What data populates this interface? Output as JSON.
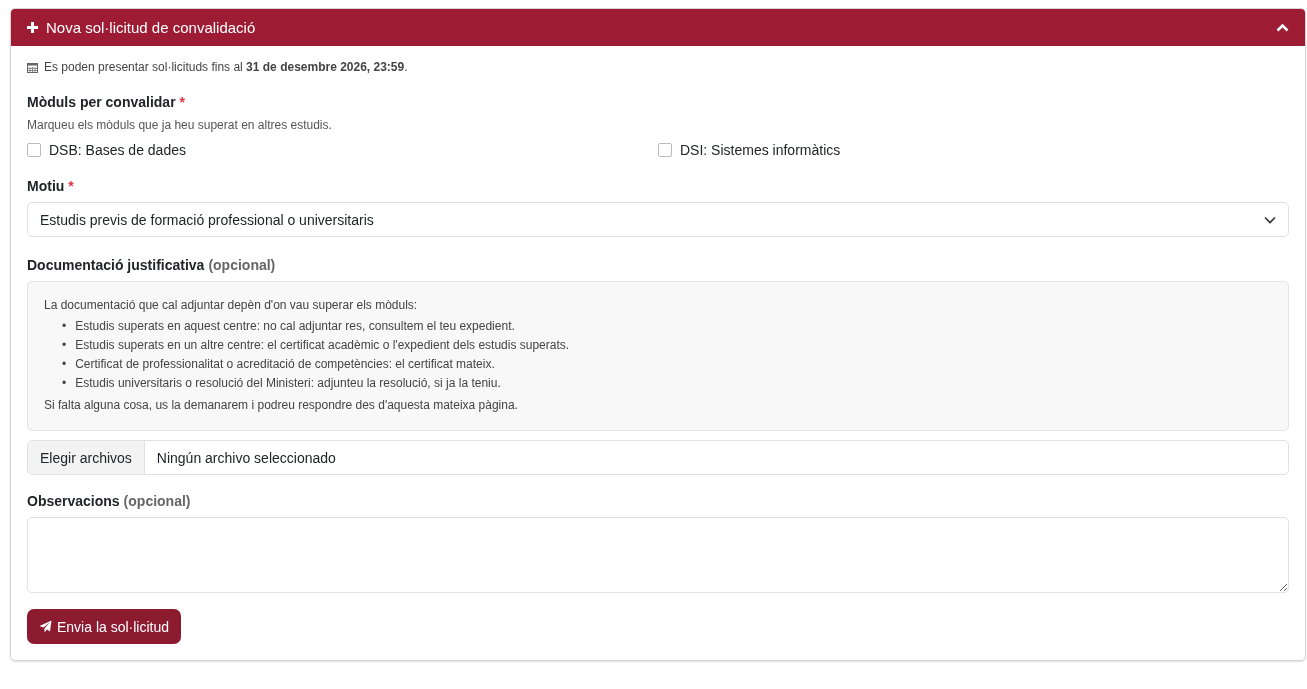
{
  "header": {
    "title": "Nova sol·licitud de convalidació",
    "expanded": true
  },
  "deadline": "Es poden presentar sol·licituds fins al **31 de desembre 2026, 23:59**.",
  "modules": {
    "label": "Mòduls per convalidar",
    "required_mark": "*",
    "hint": "Marqueu els mòduls que ja heu superat en altres estudis.",
    "options": [
      {
        "label": "DSB: Bases de dades",
        "checked": false
      },
      {
        "label": "DSI: Sistemes informàtics",
        "checked": false
      }
    ]
  },
  "reason": {
    "label": "Motiu",
    "required_mark": "*",
    "value": "Estudis previs de formació professional o universitaris"
  },
  "documents": {
    "label": "Documentació justificativa",
    "optional": "(opcional)",
    "intro": "La documentació que cal adjuntar depèn d'on vau superar els mòduls:",
    "bullet": "•",
    "items": [
      "Estudis superats en aquest centre: no cal adjuntar res, consultem el teu expedient.",
      "Estudis superats en un altre centre: el certificat acadèmic o l'expedient dels estudis superats.",
      "Certificat de professionalitat o acreditació de competències: el certificat mateix.",
      "Estudis universitaris o resolució del Ministeri: adjunteu la resolució, si ja la teniu."
    ],
    "outro": "Si falta alguna cosa, us la demanarem i podreu respondre des d'aquesta mateixa pàgina.",
    "file_button": "Elegir archivos",
    "file_status": "Ningún archivo seleccionado"
  },
  "notes": {
    "label": "Observacions",
    "optional": "(opcional)"
  },
  "submit": "Envia la sol·licitud"
}
